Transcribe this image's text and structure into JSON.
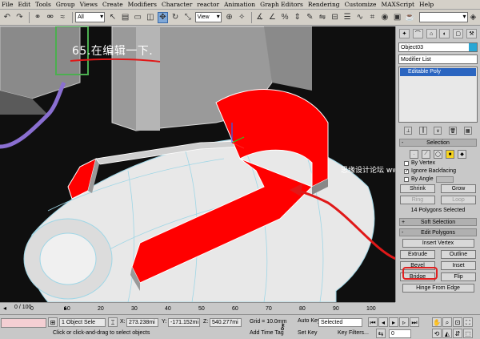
{
  "menu": [
    "File",
    "Edit",
    "Tools",
    "Group",
    "Views",
    "Create",
    "Modifiers",
    "Character",
    "reactor",
    "Animation",
    "Graph Editors",
    "Rendering",
    "Customize",
    "MAXScript",
    "Help"
  ],
  "toolbar": {
    "selection_filter": "All",
    "ref_coord": "View"
  },
  "viewport": {
    "annotation": "65.在编辑一下.",
    "watermark": "思缘设计论坛 www.MISSYUAN.COM",
    "colors": {
      "background": "#6e6e6e",
      "selected_poly": "#ff0000",
      "arrow": "#e01818",
      "mesh": "#e8e8e8",
      "wire": "#9fd6e6"
    }
  },
  "command_panel": {
    "tabs": [
      "create-icon",
      "modify-icon",
      "hierarchy-icon",
      "motion-icon",
      "display-icon",
      "utilities-icon"
    ],
    "object_name": "Object03",
    "object_color": "#2aa7d5",
    "modifier_list": "Modifier List",
    "stack_item": "Editable Poly",
    "selection": {
      "title": "Selection",
      "by_vertex": "By Vertex",
      "ignore_backfacing": "Ignore Backfacing",
      "by_angle": "By Angle",
      "by_angle_value": "45.0",
      "shrink": "Shrink",
      "grow": "Grow",
      "ring": "Ring",
      "loop": "Loop",
      "status": "14 Polygons Selected"
    },
    "soft_selection": "Soft Selection",
    "edit_polygons": {
      "title": "Edit Polygons",
      "insert_vertex": "Insert Vertex",
      "extrude": "Extrude",
      "outline": "Outline",
      "bevel": "Bevel",
      "inset": "Inset",
      "bridge": "Bridge",
      "flip": "Flip",
      "hinge": "Hinge From Edge"
    }
  },
  "timeline": {
    "frame": "0 / 100",
    "ticks": [
      "0",
      "10",
      "20",
      "30",
      "40",
      "50",
      "60",
      "70",
      "80",
      "90",
      "100"
    ]
  },
  "status": {
    "selection": "1 Object Sele",
    "prompt": "Click or click-and-drag to select objects",
    "x_label": "X:",
    "x_value": "273.238mi",
    "y_label": "Y:",
    "y_value": "-171.152mi",
    "z_label": "Z:",
    "z_value": "540.277mi",
    "grid": "Grid = 10.0mm",
    "add_time_tag": "Add Time Tag",
    "auto_key": "Auto Key",
    "auto_key_value": "Selected",
    "set_key": "Set Key",
    "key_filters": "Key Filters...",
    "frame_field": "0"
  }
}
